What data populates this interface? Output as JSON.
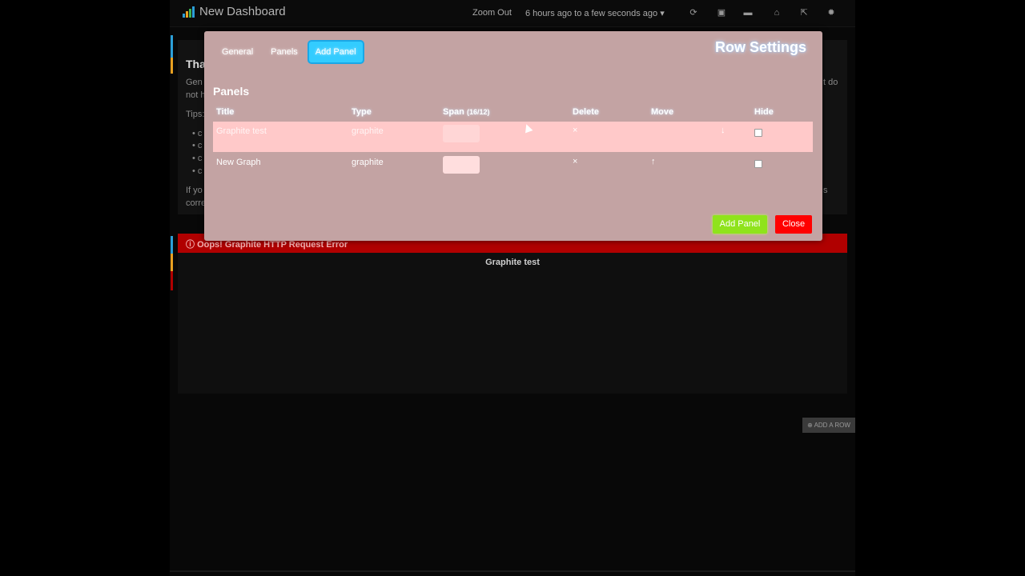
{
  "nav": {
    "title": "New Dashboard",
    "zoom_out": "Zoom Out",
    "time_range": "6 hours ago to a few seconds ago",
    "icons": [
      "refresh-icon",
      "save-icon",
      "folder-icon",
      "home-icon",
      "share-icon",
      "gear-icon"
    ]
  },
  "background": {
    "heading": "Tha",
    "text_line1": "Gen",
    "text_line2": "not h",
    "tips": "Tips:",
    "bullets": [
      "c",
      "c",
      "c",
      "c"
    ],
    "footer_line1": "If yo",
    "footer_line2": "corre",
    "right_text1": "t do",
    "right_text2": "s",
    "error_text": "Oops! Graphite HTTP Request Error",
    "graph_title": "Graphite test",
    "add_row": "ADD A ROW"
  },
  "modal": {
    "tabs": [
      "General",
      "Panels",
      "Add Panel"
    ],
    "active_tab": "Add Panel",
    "title": "Row Settings",
    "section_title": "Panels",
    "columns": {
      "title": "Title",
      "type": "Type",
      "span": "Span",
      "span_note": "(16/12)",
      "delete": "Delete",
      "move": "Move",
      "hide": "Hide"
    },
    "rows": [
      {
        "title": "Graphite test",
        "type": "graphite",
        "move": "↓"
      },
      {
        "title": "New Graph",
        "type": "graphite",
        "move": "↑"
      }
    ],
    "delete_icon": "×",
    "buttons": {
      "add_panel": "Add Panel",
      "close": "Close"
    }
  },
  "colors": {
    "modal_bg": "#c3a3a3",
    "active_tab": "#33ccff",
    "add_button": "#8fe31c",
    "close_button": "#ff0000",
    "error_bar": "#b00000"
  }
}
